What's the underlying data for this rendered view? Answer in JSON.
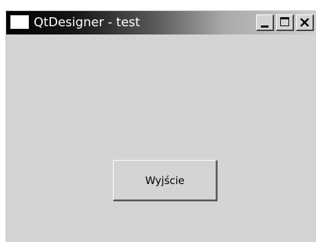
{
  "window": {
    "title": "QtDesigner - test",
    "controls": {
      "minimize": "minimize-icon",
      "maximize": "maximize-icon",
      "close": "close-icon"
    }
  },
  "content": {
    "exit_button_label": "Wyjście"
  },
  "colors": {
    "client_background": "#d4d4d4",
    "title_gradient_start": "#000000",
    "title_gradient_end": "#cfcfcf",
    "title_text": "#ffffff"
  }
}
